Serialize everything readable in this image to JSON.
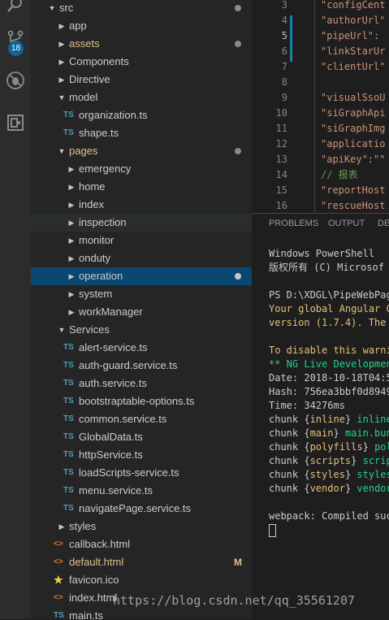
{
  "activity_bar": {
    "icons": [
      "search-icon",
      "source-control-icon",
      "debug-icon",
      "extensions-icon"
    ],
    "scm_badge": "18"
  },
  "explorer": {
    "rows": [
      {
        "label": "src",
        "kind": "folder-open",
        "depth": 0,
        "dot": true
      },
      {
        "label": "app",
        "kind": "folder",
        "depth": 1
      },
      {
        "label": "assets",
        "kind": "folder",
        "depth": 1,
        "modified": true,
        "dot": true
      },
      {
        "label": "Components",
        "kind": "folder",
        "depth": 1
      },
      {
        "label": "Directive",
        "kind": "folder",
        "depth": 1
      },
      {
        "label": "model",
        "kind": "folder-open",
        "depth": 1
      },
      {
        "label": "organization.ts",
        "kind": "ts",
        "depth": 2
      },
      {
        "label": "shape.ts",
        "kind": "ts",
        "depth": 2
      },
      {
        "label": "pages",
        "kind": "folder-open",
        "depth": 1,
        "modified": true,
        "dot": true
      },
      {
        "label": "emergency",
        "kind": "folder",
        "depth": 2
      },
      {
        "label": "home",
        "kind": "folder",
        "depth": 2
      },
      {
        "label": "index",
        "kind": "folder",
        "depth": 2
      },
      {
        "label": "inspection",
        "kind": "folder",
        "depth": 2,
        "hover": true
      },
      {
        "label": "monitor",
        "kind": "folder",
        "depth": 2
      },
      {
        "label": "onduty",
        "kind": "folder",
        "depth": 2
      },
      {
        "label": "operation",
        "kind": "folder",
        "depth": 2,
        "selected": true,
        "dot": true
      },
      {
        "label": "system",
        "kind": "folder",
        "depth": 2
      },
      {
        "label": "workManager",
        "kind": "folder",
        "depth": 2
      },
      {
        "label": "Services",
        "kind": "folder-open",
        "depth": 1
      },
      {
        "label": "alert-service.ts",
        "kind": "ts",
        "depth": 2
      },
      {
        "label": "auth-guard.service.ts",
        "kind": "ts",
        "depth": 2
      },
      {
        "label": "auth.service.ts",
        "kind": "ts",
        "depth": 2
      },
      {
        "label": "bootstraptable-options.ts",
        "kind": "ts",
        "depth": 2
      },
      {
        "label": "common.service.ts",
        "kind": "ts",
        "depth": 2
      },
      {
        "label": "GlobalData.ts",
        "kind": "ts",
        "depth": 2
      },
      {
        "label": "httpService.ts",
        "kind": "ts",
        "depth": 2
      },
      {
        "label": "loadScripts-service.ts",
        "kind": "ts",
        "depth": 2
      },
      {
        "label": "menu.service.ts",
        "kind": "ts",
        "depth": 2
      },
      {
        "label": "navigatePage.service.ts",
        "kind": "ts",
        "depth": 2
      },
      {
        "label": "styles",
        "kind": "folder",
        "depth": 1
      },
      {
        "label": "callback.html",
        "kind": "html",
        "depth": 1
      },
      {
        "label": "default.html",
        "kind": "html",
        "depth": 1,
        "modified": true,
        "flag": "M"
      },
      {
        "label": "favicon.ico",
        "kind": "fav",
        "depth": 1
      },
      {
        "label": "index.html",
        "kind": "html",
        "depth": 1
      },
      {
        "label": "main.ts",
        "kind": "ts",
        "depth": 1
      }
    ]
  },
  "editor": {
    "lines": [
      {
        "n": "3",
        "text": "\"configCent",
        "cls": "str"
      },
      {
        "n": "4",
        "text": "\"authorUrl\"",
        "cls": "str"
      },
      {
        "n": "5",
        "text": "\"pipeUrl\": ",
        "cls": "str",
        "active": true
      },
      {
        "n": "6",
        "text": "\"linkStarUr",
        "cls": "str"
      },
      {
        "n": "7",
        "text": "\"clientUrl\"",
        "cls": "str"
      },
      {
        "n": "8",
        "text": "",
        "cls": "str"
      },
      {
        "n": "9",
        "text": "\"visualSsoU",
        "cls": "str"
      },
      {
        "n": "10",
        "text": "\"siGraphApi",
        "cls": "str"
      },
      {
        "n": "11",
        "text": "\"siGraphImg",
        "cls": "str"
      },
      {
        "n": "12",
        "text": "\"applicatio",
        "cls": "str"
      },
      {
        "n": "13",
        "text": "\"apiKey\":\"\"",
        "cls": "str"
      },
      {
        "n": "14",
        "text": "// 报表",
        "cls": "cmt"
      },
      {
        "n": "15",
        "text": "\"reportHost",
        "cls": "str"
      },
      {
        "n": "16",
        "text": "\"rescueHost",
        "cls": "str"
      }
    ]
  },
  "panel": {
    "tabs": [
      "PROBLEMS",
      "OUTPUT",
      "DE"
    ],
    "terminal": [
      {
        "parts": [
          {
            "t": "Windows PowerShell",
            "c": ""
          }
        ]
      },
      {
        "parts": [
          {
            "t": "版权所有 (C) Microsof",
            "c": ""
          }
        ]
      },
      {
        "parts": [
          {
            "t": "",
            "c": ""
          }
        ]
      },
      {
        "parts": [
          {
            "t": "PS D:\\XDGL\\PipeWebPag",
            "c": ""
          }
        ]
      },
      {
        "parts": [
          {
            "t": "Your global Angular C",
            "c": "warn"
          }
        ]
      },
      {
        "parts": [
          {
            "t": "version (1.7.4). The ",
            "c": "warn"
          }
        ]
      },
      {
        "parts": [
          {
            "t": "",
            "c": ""
          }
        ]
      },
      {
        "parts": [
          {
            "t": "To disable this warni",
            "c": "warn"
          }
        ]
      },
      {
        "parts": [
          {
            "t": "** NG Live Developmen",
            "c": "green"
          }
        ]
      },
      {
        "parts": [
          {
            "t": "Date: 2018-10-18T04:5",
            "c": ""
          }
        ]
      },
      {
        "parts": [
          {
            "t": "Hash: 756ea3bbf0d8949",
            "c": ""
          }
        ]
      },
      {
        "parts": [
          {
            "t": "Time: 34276ms",
            "c": ""
          }
        ]
      },
      {
        "parts": [
          {
            "t": "chunk {",
            "c": ""
          },
          {
            "t": "inline",
            "c": "warn"
          },
          {
            "t": "} ",
            "c": ""
          },
          {
            "t": "inline",
            "c": "green"
          }
        ]
      },
      {
        "parts": [
          {
            "t": "chunk {",
            "c": ""
          },
          {
            "t": "main",
            "c": "warn"
          },
          {
            "t": "} ",
            "c": ""
          },
          {
            "t": "main.bun",
            "c": "green"
          }
        ]
      },
      {
        "parts": [
          {
            "t": "chunk {",
            "c": ""
          },
          {
            "t": "polyfills",
            "c": "warn"
          },
          {
            "t": "} ",
            "c": ""
          },
          {
            "t": "pol",
            "c": "green"
          }
        ]
      },
      {
        "parts": [
          {
            "t": "chunk {",
            "c": ""
          },
          {
            "t": "scripts",
            "c": "warn"
          },
          {
            "t": "} ",
            "c": ""
          },
          {
            "t": "script",
            "c": "green"
          }
        ]
      },
      {
        "parts": [
          {
            "t": "chunk {",
            "c": ""
          },
          {
            "t": "styles",
            "c": "warn"
          },
          {
            "t": "} ",
            "c": ""
          },
          {
            "t": "styles",
            "c": "green"
          }
        ]
      },
      {
        "parts": [
          {
            "t": "chunk {",
            "c": ""
          },
          {
            "t": "vendor",
            "c": "warn"
          },
          {
            "t": "} ",
            "c": ""
          },
          {
            "t": "vendor",
            "c": "green"
          }
        ]
      },
      {
        "parts": [
          {
            "t": "",
            "c": ""
          }
        ]
      },
      {
        "parts": [
          {
            "t": "webpack: Compiled suc",
            "c": ""
          }
        ]
      }
    ]
  },
  "watermark": "https://blog.csdn.net/qq_35561207",
  "colors": {
    "accent": "#094771",
    "modified": "#e2c08d",
    "badge": "#0e639c"
  }
}
